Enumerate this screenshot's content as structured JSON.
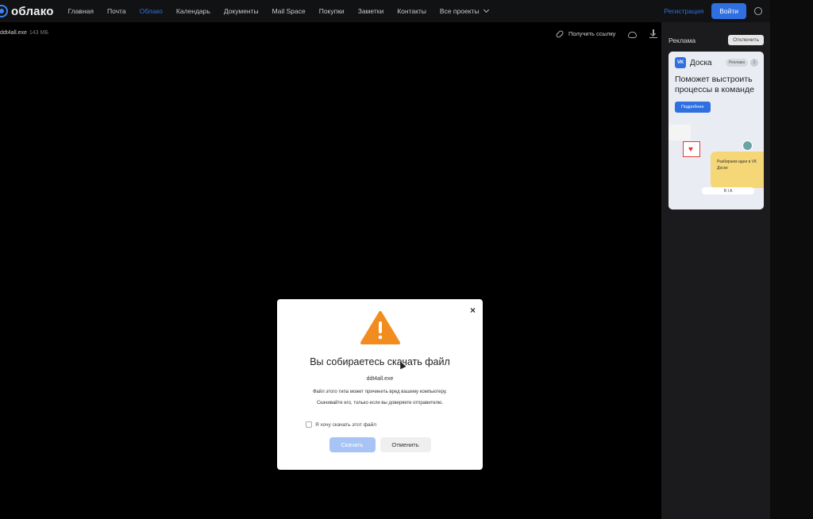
{
  "header": {
    "logo_text": "облако",
    "nav": [
      "Главная",
      "Почта",
      "Облако",
      "Календарь",
      "Документы",
      "Mail Space",
      "Покупки",
      "Заметки",
      "Контакты",
      "Все проекты"
    ],
    "active_nav": "Облако",
    "register_label": "Регистрация",
    "login_label": "Войти"
  },
  "file": {
    "name": "ddt4all.exe",
    "size": "143 МБ",
    "get_link_label": "Получить ссылку"
  },
  "sidebar": {
    "ad_label": "Реклама",
    "disable_label": "Отключить",
    "ad": {
      "brand": "Доска",
      "badge": "Реклама",
      "info": "i",
      "title": "Поможет выстроить процессы в команде",
      "button": "Подробнее",
      "sticky_text": "Разбираем идеи в VK Доске",
      "toolbar": "B I A"
    }
  },
  "modal": {
    "title": "Вы собираетесь скачать файл",
    "filename": "ddt4all.exe",
    "warning_line1": "Файл этого типа может причинить вред вашему компьютеру.",
    "warning_line2": "Скачивайте его, только если вы доверяете отправителю.",
    "checkbox_label": "Я хочу скачать этот файл",
    "download_label": "Скачать",
    "cancel_label": "Отменить",
    "close": "×"
  },
  "colors": {
    "accent": "#2f6fe0",
    "warning": "#f28c1e"
  }
}
